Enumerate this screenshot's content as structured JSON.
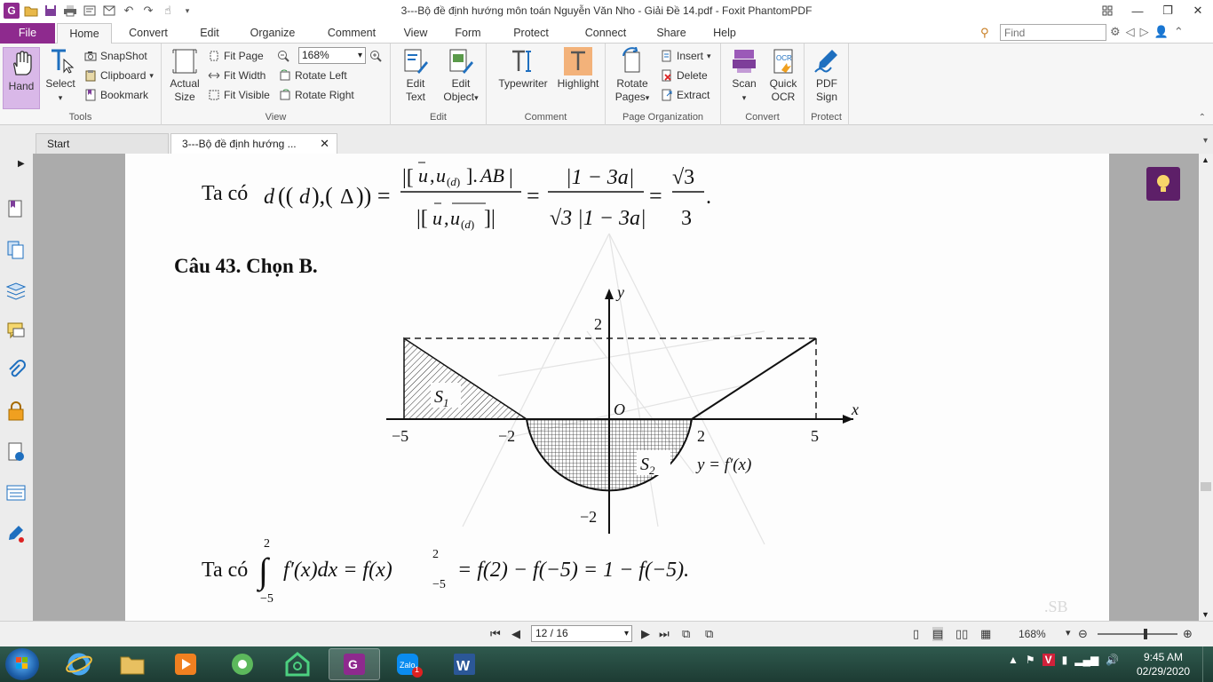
{
  "window": {
    "title": "3---Bộ đề định hướng môn toán Nguyễn Văn Nho - Giải Đề 14.pdf - Foxit PhantomPDF"
  },
  "menu": {
    "tabs": [
      "File",
      "Home",
      "Convert",
      "Edit",
      "Organize",
      "Comment",
      "View",
      "Form",
      "Protect",
      "Connect",
      "Share",
      "Help"
    ],
    "active": "Home",
    "find_placeholder": "Find"
  },
  "ribbon": {
    "tools": {
      "label": "Tools",
      "hand": "Hand",
      "select": "Select",
      "snapshot": "SnapShot",
      "clipboard": "Clipboard",
      "bookmark": "Bookmark"
    },
    "view": {
      "label": "View",
      "actual_size_1": "Actual",
      "actual_size_2": "Size",
      "fit_page": "Fit Page",
      "fit_width": "Fit Width",
      "fit_visible": "Fit Visible",
      "zoom": "168%",
      "rotate_left": "Rotate Left",
      "rotate_right": "Rotate Right"
    },
    "edit": {
      "label": "Edit",
      "edit_text_1": "Edit",
      "edit_text_2": "Text",
      "edit_object_1": "Edit",
      "edit_object_2": "Object"
    },
    "comment": {
      "label": "Comment",
      "typewriter": "Typewriter",
      "highlight": "Highlight"
    },
    "page_org": {
      "label": "Page Organization",
      "rotate_pages_1": "Rotate",
      "rotate_pages_2": "Pages",
      "insert": "Insert",
      "delete": "Delete",
      "extract": "Extract"
    },
    "convert": {
      "label": "Convert",
      "scan": "Scan",
      "quick_ocr_1": "Quick",
      "quick_ocr_2": "OCR"
    },
    "protect": {
      "label": "Protect",
      "pdf_sign_1": "PDF",
      "pdf_sign_2": "Sign"
    }
  },
  "doc_tabs": [
    {
      "label": "Start"
    },
    {
      "label": "3---Bộ đề định hướng ..."
    }
  ],
  "document": {
    "line1_prefix": "Ta có",
    "line1_frac2_num": "|1 − 3a|",
    "line1_frac2_den": "√3 |1 − 3a|",
    "line1_frac3_num": "√3",
    "line1_frac3_den": "3",
    "heading": "Câu 43. Chọn B.",
    "graph": {
      "y_axis": "y",
      "x_axis": "x",
      "origin": "O",
      "tick_y_top": "2",
      "tick_y_bottom": "−2",
      "tick_x_m5": "−5",
      "tick_x_m2": "−2",
      "tick_x_2": "2",
      "tick_x_5": "5",
      "s1": "S",
      "s1_sub": "1",
      "s2": "S",
      "s2_sub": "2",
      "curve_label": "y = f′(x)"
    },
    "bottom_line_prefix": "Ta có",
    "bottom_line": "f′(x)dx = f(x)",
    "bottom_line_rest": "= f(2) − f(−5) = 1 − f(−5).",
    "integral_upper": "2",
    "integral_lower": "−5",
    "eval_upper": "2",
    "eval_lower": "−5"
  },
  "status": {
    "page": "12 / 16",
    "zoom": "168%"
  },
  "taskbar": {
    "time": "9:45 AM",
    "date": "02/29/2020",
    "zalo_badge": "1"
  },
  "colors": {
    "accent": "#8e2a8e",
    "ribbon_bg": "#f6f6f6",
    "doc_bg": "#ababab",
    "taskbar": "#1d3b33"
  }
}
